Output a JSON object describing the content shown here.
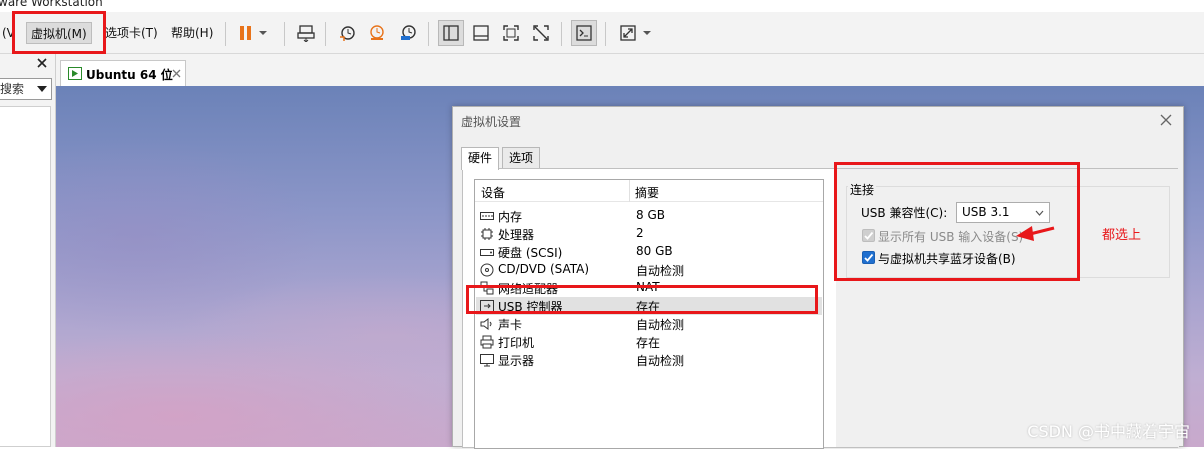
{
  "window": {
    "title": "ware Workstation"
  },
  "menu": {
    "items": [
      "(V",
      "虚拟机(M)",
      "选项卡(T)",
      "帮助(H)"
    ]
  },
  "library": {
    "search_placeholder": "搜索"
  },
  "tabs": [
    {
      "label": "Ubuntu 64 位"
    }
  ],
  "dialog": {
    "title": "虚拟机设置",
    "tabs": [
      "硬件",
      "选项"
    ],
    "device_table": {
      "headers": [
        "设备",
        "摘要"
      ],
      "rows": [
        {
          "icon": "memory-icon",
          "device": "内存",
          "summary": "8 GB"
        },
        {
          "icon": "cpu-icon",
          "device": "处理器",
          "summary": "2"
        },
        {
          "icon": "harddisk-icon",
          "device": "硬盘 (SCSI)",
          "summary": "80 GB"
        },
        {
          "icon": "cd-dvd-icon",
          "device": "CD/DVD (SATA)",
          "summary": "自动检测"
        },
        {
          "icon": "network-icon",
          "device": "网络适配器",
          "summary": "NAT"
        },
        {
          "icon": "usb-icon",
          "device": "USB 控制器",
          "summary": "存在",
          "selected": true
        },
        {
          "icon": "sound-icon",
          "device": "声卡",
          "summary": "自动检测"
        },
        {
          "icon": "printer-icon",
          "device": "打印机",
          "summary": "存在"
        },
        {
          "icon": "display-icon",
          "device": "显示器",
          "summary": "自动检测"
        }
      ]
    },
    "connection": {
      "group_label": "连接",
      "compat_label": "USB 兼容性(C):",
      "compat_value": "USB 3.1",
      "show_all_label": "显示所有 USB 输入设备(S)",
      "show_all_checked": true,
      "show_all_enabled": false,
      "share_bt_label": "与虚拟机共享蓝牙设备(B)",
      "share_bt_checked": true
    }
  },
  "annotation": {
    "text": "都选上",
    "color": "#e8171a"
  },
  "watermark": "CSDN @书中藏着宇宙"
}
